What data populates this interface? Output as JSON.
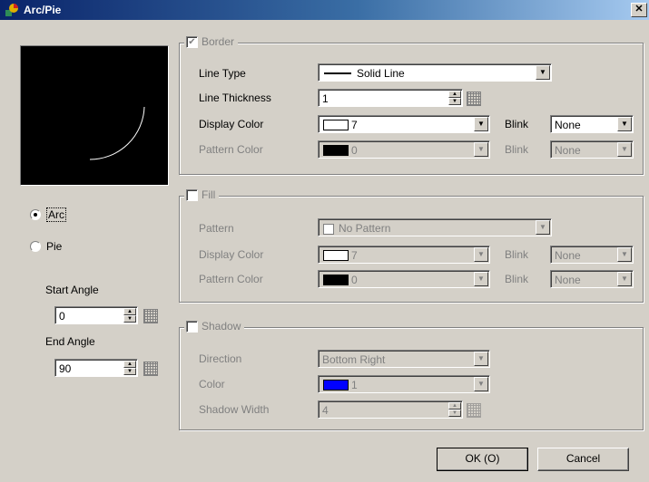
{
  "window": {
    "title": "Arc/Pie",
    "close_glyph": "✕"
  },
  "shape_mode": {
    "arc_label": "Arc",
    "pie_label": "Pie",
    "selected": "Arc"
  },
  "angles": {
    "start_label": "Start Angle",
    "start_value": "0",
    "end_label": "End Angle",
    "end_value": "90"
  },
  "border": {
    "legend": "Border",
    "checked": true,
    "line_type_label": "Line Type",
    "line_type_value": "Solid Line",
    "line_thickness_label": "Line Thickness",
    "line_thickness_value": "1",
    "display_color_label": "Display Color",
    "display_color_value": "7",
    "blink_label": "Blink",
    "blink_value": "None",
    "pattern_color_label": "Pattern Color",
    "pattern_color_value": "0",
    "pattern_blink_label": "Blink",
    "pattern_blink_value": "None"
  },
  "fill": {
    "legend": "Fill",
    "checked": false,
    "pattern_label": "Pattern",
    "pattern_value": "No Pattern",
    "display_color_label": "Display Color",
    "display_color_value": "7",
    "blink_label": "Blink",
    "blink_value": "None",
    "pattern_color_label": "Pattern Color",
    "pattern_color_value": "0",
    "pattern_blink_label": "Blink",
    "pattern_blink_value": "None"
  },
  "shadow": {
    "legend": "Shadow",
    "checked": false,
    "direction_label": "Direction",
    "direction_value": "Bottom Right",
    "color_label": "Color",
    "color_value": "1",
    "color_hex": "#0000ff",
    "width_label": "Shadow Width",
    "width_value": "4"
  },
  "buttons": {
    "ok": "OK (O)",
    "cancel": "Cancel"
  }
}
